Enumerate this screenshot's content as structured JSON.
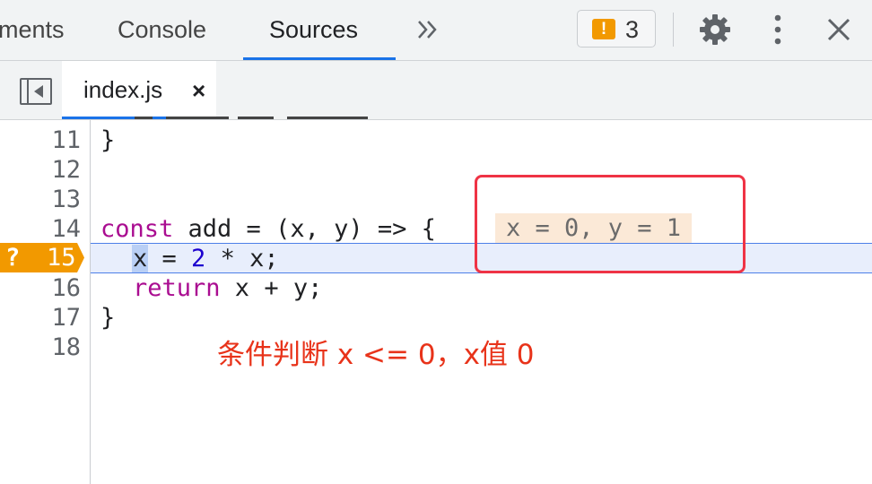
{
  "toolbar": {
    "tabs": [
      {
        "label": "ments"
      },
      {
        "label": "Console"
      },
      {
        "label": "Sources",
        "active": true
      }
    ],
    "more_tabs_icon": "chevron-double-right-icon",
    "issues": {
      "icon": "warning-icon",
      "icon_glyph": "!",
      "count": "3"
    },
    "settings_icon": "gear-icon",
    "menu_icon": "kebab-menu-icon",
    "close_icon": "close-icon"
  },
  "file_tabs": {
    "navigator_toggle_icon": "panel-toggle-icon",
    "files": [
      {
        "name": "index.js",
        "close": "×"
      }
    ]
  },
  "editor": {
    "lines": [
      {
        "number": "11",
        "code": "}"
      },
      {
        "number": "12",
        "code": ""
      },
      {
        "number": "13",
        "code": ""
      },
      {
        "number": "14",
        "code_parts": [
          "const",
          " add = (x, y) => {"
        ]
      },
      {
        "number": "15",
        "code_parts": [
          "x",
          " = ",
          "2",
          " * x;"
        ],
        "breakpoint": true
      },
      {
        "number": "16",
        "code_parts": [
          "return",
          " x + y;"
        ]
      },
      {
        "number": "17",
        "code": "}"
      },
      {
        "number": "18",
        "code": ""
      }
    ],
    "breakpoint_marker": "?",
    "inline_values": "x = 0, y = 1",
    "colors": {
      "breakpoint": "#f29900",
      "exec_highlight": "#e8eefc",
      "keyword": "#aa0d91",
      "number": "#1c00cf"
    }
  },
  "annotation": {
    "text": "条件判断 x <= 0，x值 0",
    "color": "#e8331a",
    "box_color": "#ef3345"
  }
}
